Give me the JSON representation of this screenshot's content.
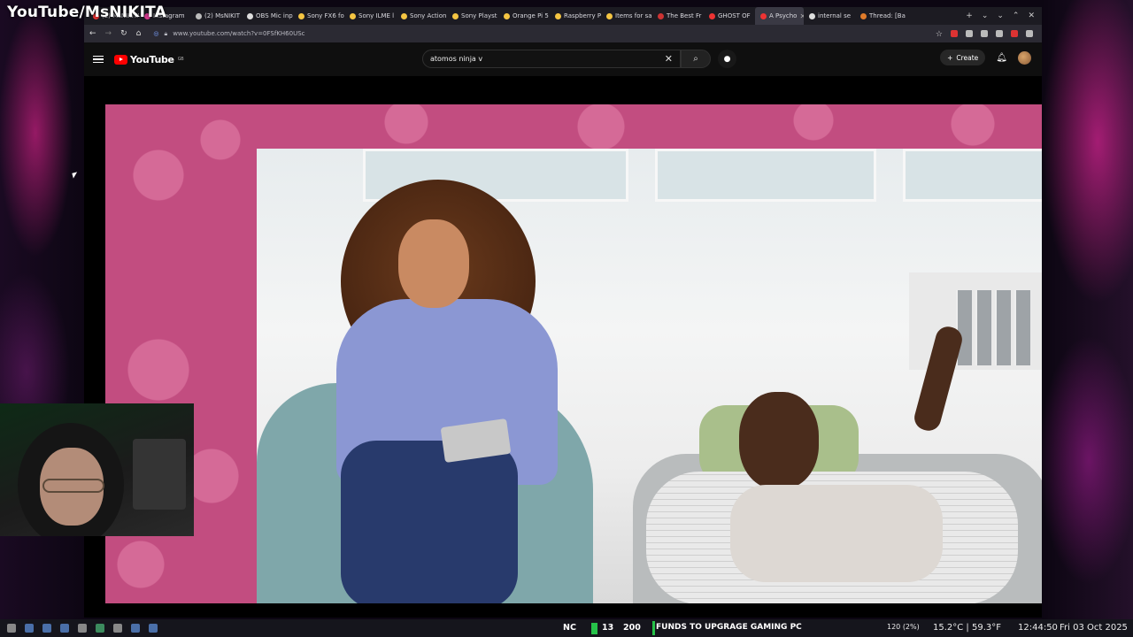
{
  "overlay_title": "YouTube/MsNIKITA",
  "browser": {
    "tabs": [
      {
        "label": "(2) MsNIKITA",
        "fav": "#e33"
      },
      {
        "label": "Instagram",
        "fav": "#d43a8f"
      },
      {
        "label": "(2) MsNIKIT",
        "fav": "#bbb"
      },
      {
        "label": "OBS Mic inp",
        "fav": "#ddd"
      },
      {
        "label": "Sony FX6 fo",
        "fav": "#f5c542"
      },
      {
        "label": "Sony ILME l",
        "fav": "#f5c542"
      },
      {
        "label": "Sony Action",
        "fav": "#f5c542"
      },
      {
        "label": "Sony Playst",
        "fav": "#f5c542"
      },
      {
        "label": "Orange Pi 5",
        "fav": "#f5c542"
      },
      {
        "label": "Raspberry P",
        "fav": "#f5c542"
      },
      {
        "label": "Items for sa",
        "fav": "#f5c542"
      },
      {
        "label": "The Best Fr",
        "fav": "#c33"
      },
      {
        "label": "GHOST OF",
        "fav": "#e33"
      },
      {
        "label": "A Psycho",
        "fav": "#e33",
        "active": true
      },
      {
        "label": "internal se",
        "fav": "#ddd"
      },
      {
        "label": "Thread: [Ba",
        "fav": "#e07b2a"
      }
    ],
    "url": "www.youtube.com/watch?v=0FSfKH60USc"
  },
  "youtube": {
    "logo_text": "YouTube",
    "country": "GB",
    "search_value": "atomos ninja v",
    "create_label": "Create"
  },
  "taskbar": {
    "nc_label": "NC",
    "count_a": "13",
    "count_b": "200",
    "goal_label": "FUNDS TO UPGRAGE GAMING PC",
    "cpu": "120 (2%)",
    "temperature": "15.2°C | 59.3°F",
    "time": "12:44:50",
    "date": "Fri 03 Oct 2025"
  },
  "icons": [
    "menu-icon",
    "search-icon",
    "mic-icon",
    "bell-icon",
    "plus-icon",
    "close-icon",
    "back-icon",
    "forward-icon",
    "reload-icon",
    "home-icon",
    "star-icon"
  ]
}
